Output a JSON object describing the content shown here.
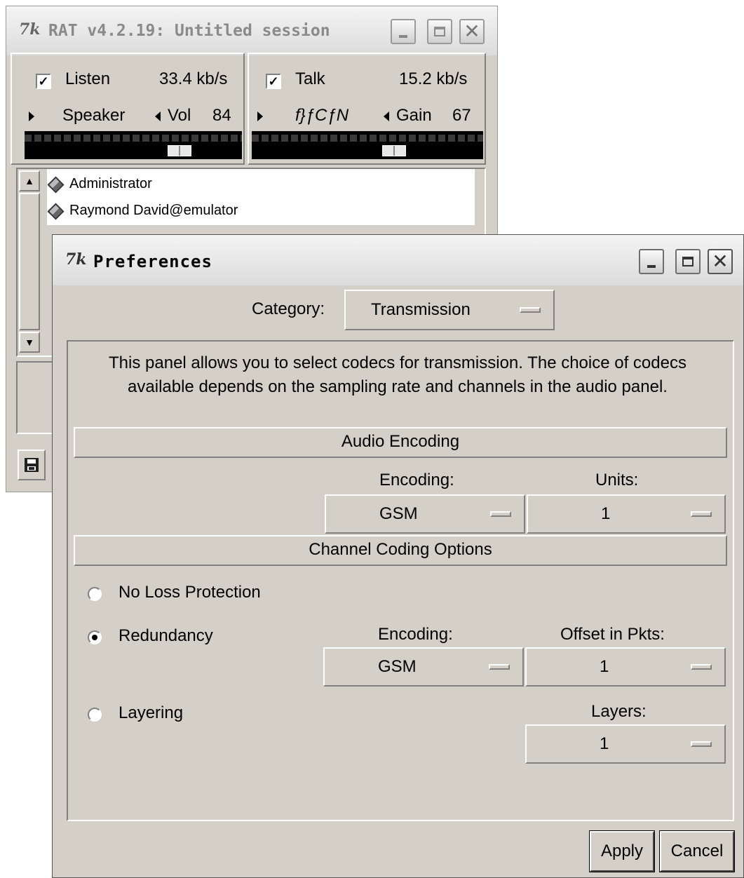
{
  "rat_window": {
    "title": "RAT v4.2.19: Untitled session",
    "listen": {
      "label": "Listen",
      "checked": true,
      "rate": "33.4 kb/s"
    },
    "speaker": {
      "device": "Speaker",
      "volume_label": "Vol",
      "volume": "84",
      "level": 0.74
    },
    "talk": {
      "label": "Talk",
      "checked": true,
      "rate": "15.2 kb/s"
    },
    "mic": {
      "device": "f}ƒCƒN",
      "gain_label": "Gain",
      "gain": "67",
      "level": 0.63
    },
    "participants": [
      "Administrator",
      "Raymond David@emulator"
    ],
    "icons": {
      "save": "floppy-disk-icon"
    }
  },
  "prefs": {
    "title": "Preferences",
    "category_label": "Category:",
    "category_value": "Transmission",
    "description": "This panel allows you to select codecs for transmission.  The choice of codecs available depends on the sampling rate and channels in the audio panel.",
    "audio_encoding": {
      "header": "Audio Encoding",
      "encoding_label": "Encoding:",
      "encoding_value": "GSM",
      "units_label": "Units:",
      "units_value": "1"
    },
    "channel_coding": {
      "header": "Channel Coding Options",
      "no_loss": "No Loss Protection",
      "redundancy": "Redundancy",
      "layering": "Layering",
      "selected": "Redundancy",
      "red_encoding_label": "Encoding:",
      "red_encoding_value": "GSM",
      "offset_label": "Offset in Pkts:",
      "offset_value": "1",
      "layers_label": "Layers:",
      "layers_value": "1"
    },
    "apply": "Apply",
    "cancel": "Cancel"
  },
  "colors": {
    "face": "#d4d0c8",
    "meter": "#000000"
  }
}
